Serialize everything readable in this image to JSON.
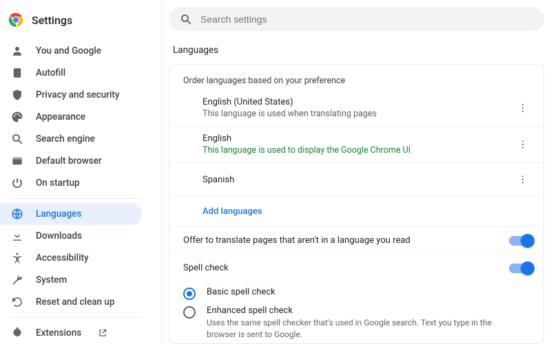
{
  "brand": {
    "title": "Settings"
  },
  "search": {
    "placeholder": "Search settings"
  },
  "sidebar": {
    "items": [
      {
        "label": "You and Google"
      },
      {
        "label": "Autofill"
      },
      {
        "label": "Privacy and security"
      },
      {
        "label": "Appearance"
      },
      {
        "label": "Search engine"
      },
      {
        "label": "Default browser"
      },
      {
        "label": "On startup"
      },
      {
        "label": "Languages"
      },
      {
        "label": "Downloads"
      },
      {
        "label": "Accessibility"
      },
      {
        "label": "System"
      },
      {
        "label": "Reset and clean up"
      },
      {
        "label": "Extensions"
      }
    ]
  },
  "page": {
    "heading": "Languages",
    "order_caption": "Order languages based on your preference",
    "langs": [
      {
        "name": "English (United States)",
        "sub": "This language is used when translating pages",
        "sub_style": "gray"
      },
      {
        "name": "English",
        "sub": "This language is used to display the Google Chrome UI",
        "sub_style": "green"
      },
      {
        "name": "Spanish",
        "sub": "",
        "sub_style": "gray"
      }
    ],
    "add": "Add languages",
    "offer_translate": "Offer to translate pages that aren't in a language you read",
    "spell_check": "Spell check",
    "spell_options": {
      "basic": "Basic spell check",
      "enhanced": "Enhanced spell check",
      "enhanced_sub": "Uses the same spell checker that's used in Google search. Text you type in the browser is sent to Google."
    }
  }
}
